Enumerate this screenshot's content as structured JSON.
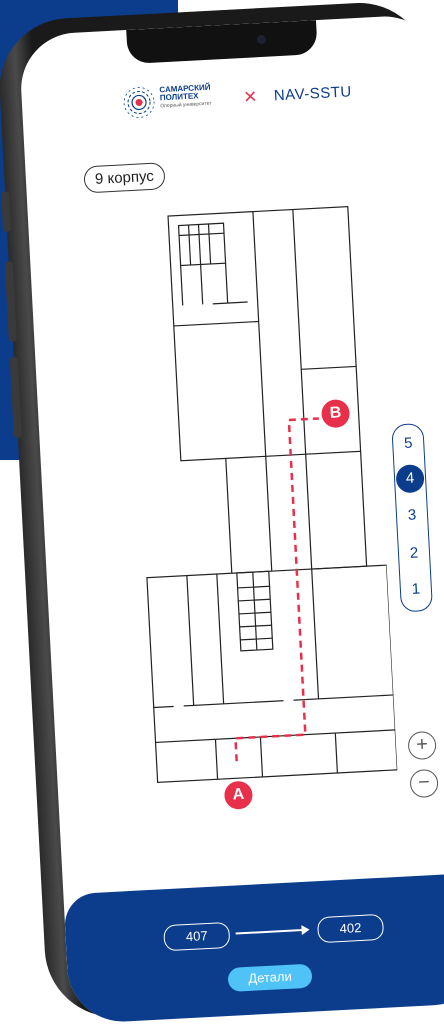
{
  "header": {
    "university_line1": "САМАРСКИЙ",
    "university_line2": "ПОЛИТЕХ",
    "university_tagline": "Опорный университет",
    "close_symbol": "×",
    "app_name": "NAV-SSTU"
  },
  "map": {
    "building_label": "9 корпус",
    "start_marker": "A",
    "end_marker": "B"
  },
  "floors": {
    "items": [
      "5",
      "4",
      "3",
      "2",
      "1"
    ],
    "active": "4"
  },
  "zoom": {
    "in_symbol": "+",
    "out_symbol": "−"
  },
  "route": {
    "from_room": "407",
    "to_room": "402",
    "details_label": "Детали"
  },
  "colors": {
    "brand": "#0b3d8c",
    "accent": "#e8304a",
    "button": "#4fc3f7"
  }
}
